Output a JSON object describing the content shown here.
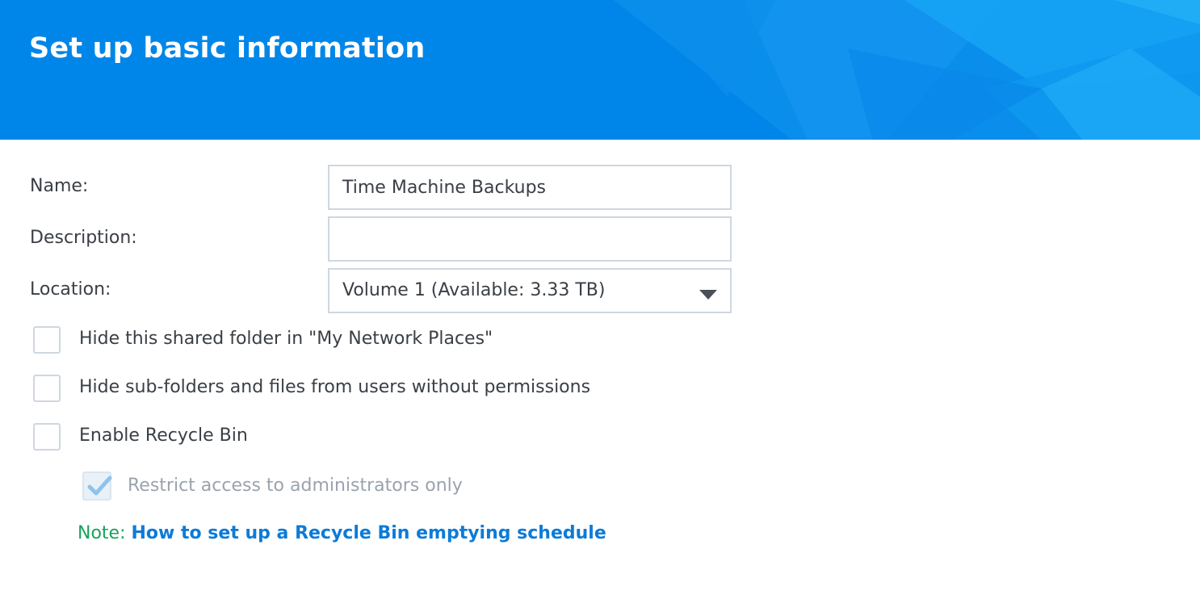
{
  "header": {
    "title": "Set up basic information"
  },
  "form": {
    "name": {
      "label": "Name:",
      "value": "Time Machine Backups",
      "placeholder": ""
    },
    "description": {
      "label": "Description:",
      "value": "",
      "placeholder": ""
    },
    "location": {
      "label": "Location:",
      "selected": "Volume 1 (Available: 3.33 TB)"
    }
  },
  "options": {
    "hide_folder": {
      "label": "Hide this shared folder in \"My Network Places\"",
      "checked": false
    },
    "hide_subfolders": {
      "label": "Hide sub-folders and files from users without permissions",
      "checked": false
    },
    "recycle_bin": {
      "label": "Enable Recycle Bin",
      "checked": false
    },
    "restrict_admin": {
      "label": "Restrict access to administrators only",
      "checked": true,
      "disabled": true
    }
  },
  "note": {
    "prefix": "Note:",
    "link_text": "How to set up a Recycle Bin emptying schedule"
  },
  "colors": {
    "header_bg": "#0086e8",
    "link": "#0c7bd8",
    "note_prefix": "#1aa15f",
    "disabled_text": "#9aa3ad",
    "check_mark": "#8ec3ec"
  },
  "icons": {
    "dropdown": "caret-down-icon",
    "checkmark": "checkmark-icon"
  }
}
